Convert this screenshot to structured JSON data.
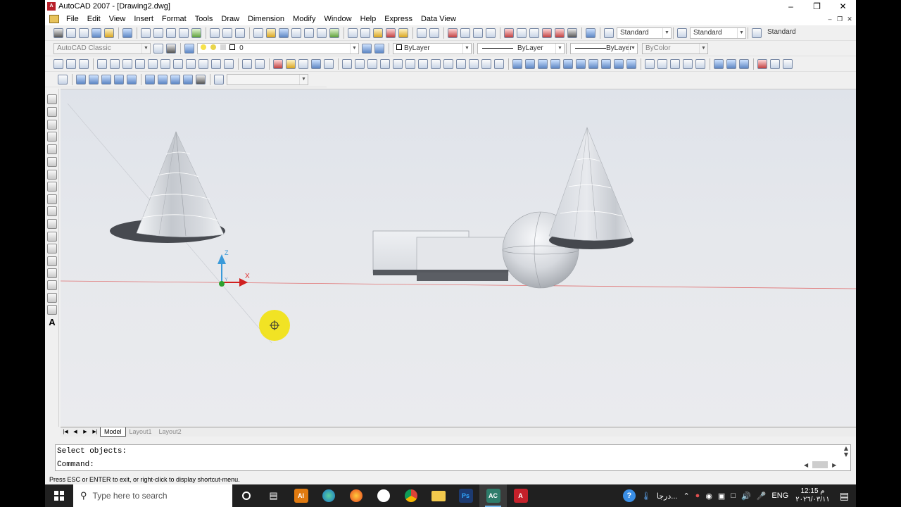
{
  "window": {
    "title": "AutoCAD 2007 - [Drawing2.dwg]",
    "app_badge": "A"
  },
  "menu": [
    "File",
    "Edit",
    "View",
    "Insert",
    "Format",
    "Tools",
    "Draw",
    "Dimension",
    "Modify",
    "Window",
    "Help",
    "Express",
    "Data View"
  ],
  "styles": {
    "text_style": "Standard",
    "dim_style": "Standard",
    "table_style": "Standard"
  },
  "workspace": "AutoCAD Classic",
  "layer": "0",
  "properties": {
    "color": "ByLayer",
    "linetype": "ByLayer",
    "lineweight": "ByLayer",
    "plotstyle": "ByColor"
  },
  "ucs": {
    "x_label": "X",
    "y_label": "Y",
    "z_label": "Z"
  },
  "draw_text_tool": "A",
  "layout_tabs": [
    {
      "label": "Model",
      "active": true
    },
    {
      "label": "Layout1",
      "active": false
    },
    {
      "label": "Layout2",
      "active": false
    }
  ],
  "command": {
    "history_line": "Select objects:",
    "prompt": "Command:"
  },
  "status_text": "Press ESC or ENTER to exit, or right-click to display shortcut-menu.",
  "taskbar": {
    "search_placeholder": "Type here to search",
    "weather": "درجا...",
    "language": "ENG",
    "time": "12:15 م",
    "date": "٢٠٢٦/٠٣/١١",
    "apps": [
      {
        "name": "AI",
        "color": "#e07a10"
      },
      {
        "name": "Ps",
        "color": "#1c3a70"
      },
      {
        "name": "AC",
        "color": "#2e7d6b"
      },
      {
        "name": "A",
        "color": "#c4202a"
      }
    ]
  },
  "colors": {
    "axis_x": "#e03030",
    "axis_z": "#3a9ad9",
    "cursor_highlight": "#f2e200"
  }
}
